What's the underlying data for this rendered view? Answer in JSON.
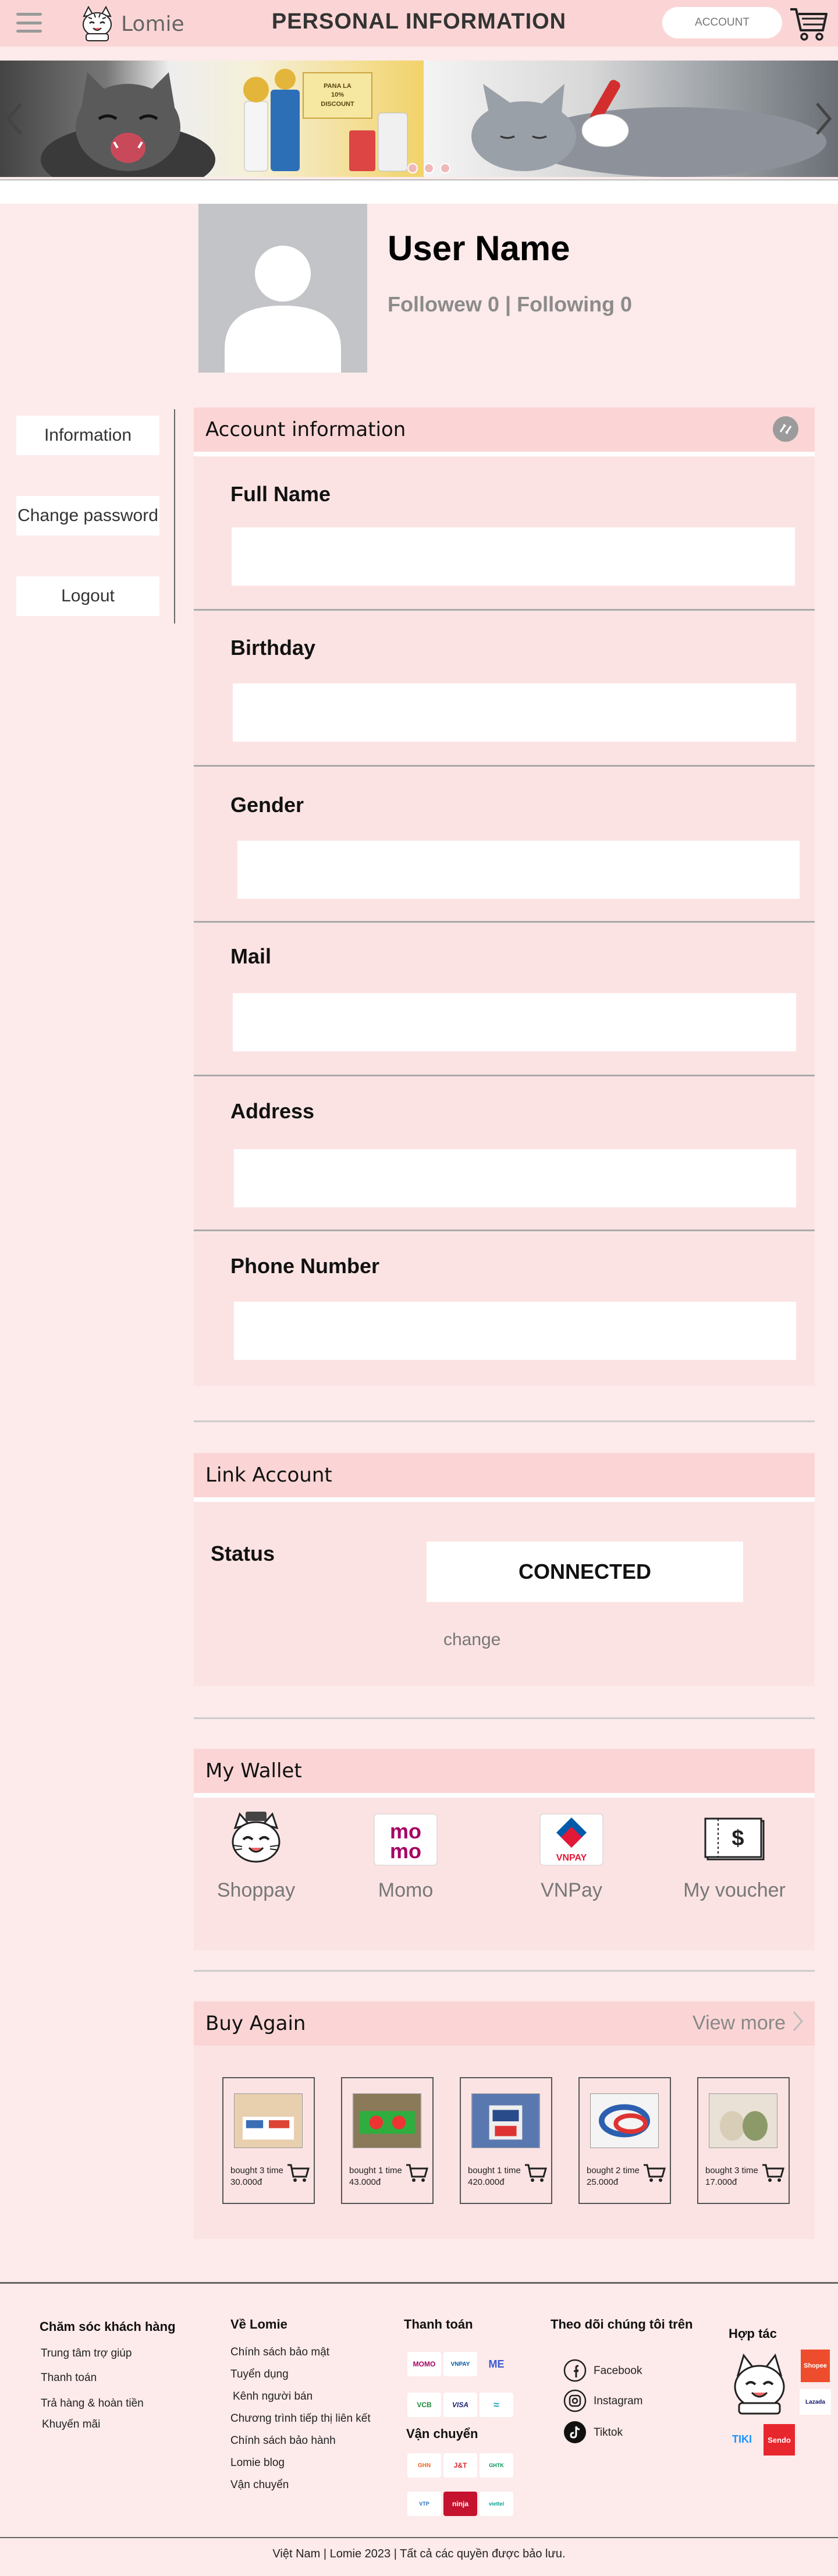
{
  "header": {
    "logo_text": "Lomie",
    "title": "PERSONAL INFORMATION",
    "account_label": "ACCOUNT",
    "icons": [
      "hamburger-icon",
      "cat-logo-icon",
      "cart-icon"
    ]
  },
  "banner": {
    "promo_line1": "PANA LA",
    "promo_line2": "10%",
    "promo_line3": "DISCOUNT",
    "slides": 3,
    "active_slide": 1
  },
  "profile": {
    "username": "User Name",
    "follow_text": "Followew 0 | Following 0"
  },
  "side_menu": {
    "items": [
      "Information",
      "Change password",
      "Logout"
    ]
  },
  "account_info": {
    "title": "Account information",
    "fields": [
      {
        "label": "Full Name",
        "value": ""
      },
      {
        "label": "Birthday",
        "value": ""
      },
      {
        "label": "Gender",
        "value": ""
      },
      {
        "label": "Mail",
        "value": ""
      },
      {
        "label": "Address",
        "value": ""
      },
      {
        "label": "Phone Number",
        "value": ""
      }
    ]
  },
  "link_account": {
    "title": "Link Account",
    "status_label": "Status",
    "status_value": "CONNECTED",
    "change_label": "change"
  },
  "wallet": {
    "title": "My Wallet",
    "items": [
      {
        "label": "Shoppay",
        "icon": "cat-wallet-icon"
      },
      {
        "label": "Momo",
        "icon": "momo-icon",
        "logo_line1": "mo",
        "logo_line2": "mo"
      },
      {
        "label": "VNPay",
        "icon": "vnpay-icon",
        "logo_text": "VNPAY"
      },
      {
        "label": "My voucher",
        "icon": "voucher-icon",
        "logo_text": "$"
      }
    ]
  },
  "buy_again": {
    "title": "Buy Again",
    "view_more": "View more",
    "products": [
      {
        "bought": "bought 3 time",
        "price": "30.000đ"
      },
      {
        "bought": "bought 1 time",
        "price": "43.000đ"
      },
      {
        "bought": "bought 1 time",
        "price": "420.000đ"
      },
      {
        "bought": "bought 2 time",
        "price": "25.000đ"
      },
      {
        "bought": "bought 3 time",
        "price": "17.000đ"
      }
    ]
  },
  "footer": {
    "customer_care": {
      "title": "Chăm sóc khách hàng",
      "links": [
        "Trung tâm trợ giúp",
        "Thanh toán",
        "Trả hàng & hoàn tiền",
        "Khuyến mãi"
      ]
    },
    "about": {
      "title": "Về Lomie",
      "links": [
        "Chính sách bảo mật",
        "Tuyển dụng",
        "Kênh người bán",
        "Chương trình tiếp thị liên kết",
        "Chính sách bảo hành",
        "Lomie blog",
        "Vận chuyển"
      ]
    },
    "payment": {
      "title": "Thanh toán",
      "logos": [
        "MOMO",
        "VNPAY",
        "ME",
        "VCB",
        "VISA",
        "≈"
      ]
    },
    "shipping": {
      "title": "Vận chuyển",
      "logos": [
        "GHN",
        "J&T",
        "GHTK",
        "VTP",
        "ninja",
        "viettel"
      ]
    },
    "social": {
      "title": "Theo dõi chúng tôi trên",
      "links": [
        "Facebook",
        "Instagram",
        "Tiktok"
      ]
    },
    "partners": {
      "title": "Hợp tác",
      "logos": [
        "Shopee",
        "Lazada",
        "TIKI",
        "Sendo"
      ]
    },
    "copyright": "Việt Nam | Lomie 2023 | Tất cả các quyền được bảo lưu."
  }
}
